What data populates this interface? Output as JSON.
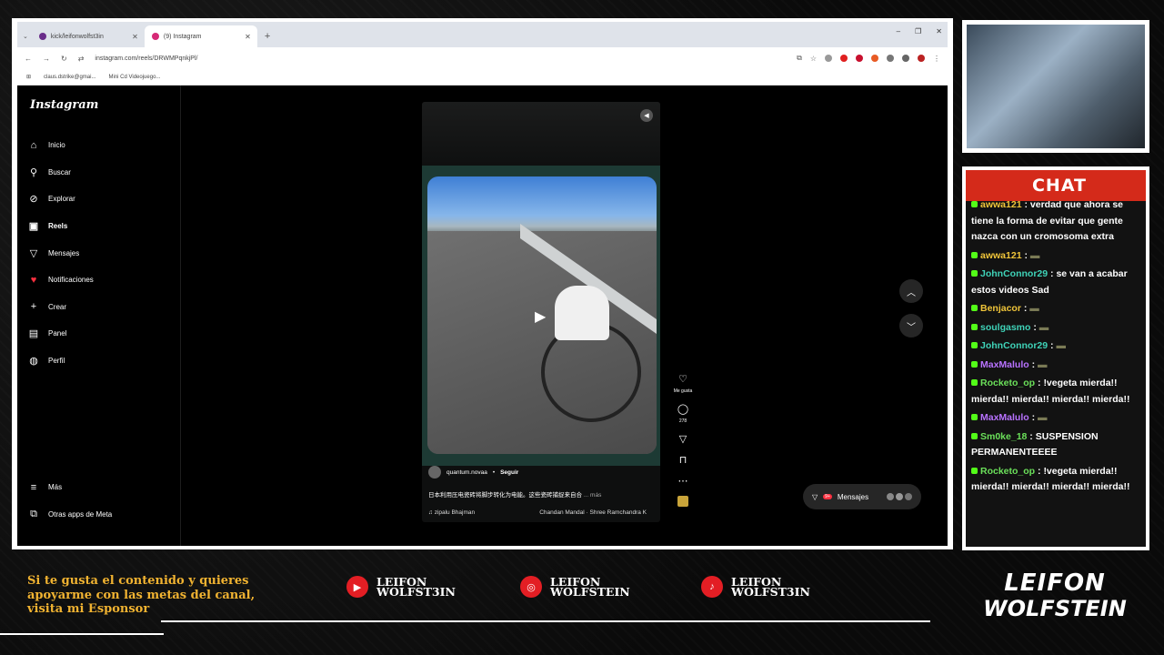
{
  "browser": {
    "tabs": [
      {
        "label": "kick/leifonwolfst3in"
      },
      {
        "label": "(9) Instagram"
      }
    ],
    "url": "instagram.com/reels/DRWMPqnkjPl/",
    "bookmarks": [
      "claus.dstrike@gmai...",
      "Mini Cd Videojuego..."
    ]
  },
  "instagram": {
    "logo": "Instagram",
    "nav": [
      "Inicio",
      "Buscar",
      "Explorar",
      "Reels",
      "Mensajes",
      "Notificaciones",
      "Crear",
      "Panel",
      "Perfil"
    ],
    "more": "Más",
    "meta_apps": "Otras apps de Meta"
  },
  "reel": {
    "username": "quantum.novaa",
    "follow": "Seguir",
    "caption": "日本利用压电瓷砖将脚步转化为电能。这些瓷砖捕捉来自合",
    "more": "... más",
    "audio_left": "zipalu Bhajman",
    "audio_right": "Chandan Mandal · Shree Ramchandra K",
    "like_label": "Me gusta",
    "comments": "278"
  },
  "messages": {
    "label": "Mensajes",
    "badge": "9+"
  },
  "chat": {
    "title": "CHAT",
    "colors": {
      "yellow": "#f0c53a",
      "green": "#6be05a",
      "teal": "#3fd3b8",
      "purple": "#b872ff"
    },
    "messages": [
      {
        "user": "awwa121",
        "color": "yellow",
        "text": "verdad que ahora se tiene la forma de evitar que gente nazca con un cromosoma extra"
      },
      {
        "user": "awwa121",
        "color": "yellow",
        "text": "[emote]"
      },
      {
        "user": "JohnConnor29",
        "color": "teal",
        "text": "se van a acabar estos videos Sad"
      },
      {
        "user": "Benjacor",
        "color": "yellow",
        "text": "[emote]"
      },
      {
        "user": "soulgasmo",
        "color": "teal",
        "text": "[emote]"
      },
      {
        "user": "JohnConnor29",
        "color": "teal",
        "text": "[emote]"
      },
      {
        "user": "MaxMalulo",
        "color": "purple",
        "text": "[emote]"
      },
      {
        "user": "Rocketo_op",
        "color": "green",
        "text": "!vegeta mierda!! mierda!! mierda!! mierda!! mierda!!"
      },
      {
        "user": "MaxMalulo",
        "color": "purple",
        "text": "[emote]"
      },
      {
        "user": "Sm0ke_18",
        "color": "green",
        "text": "SUSPENSION PERMANENTEEEE"
      },
      {
        "user": "Rocketo_op",
        "color": "green",
        "text": "!vegeta mierda!! mierda!! mierda!! mierda!! mierda!!"
      }
    ]
  },
  "footer": {
    "sponsor": [
      "Si te gusta el contenido y quieres",
      "apoyarme con las metas del canal,",
      "visita mi Esponsor"
    ],
    "social": [
      {
        "line1": "LEIFON",
        "line2": "WOLFST3IN"
      },
      {
        "line1": "LEIFON",
        "line2": "WOLFSTEIN"
      },
      {
        "line1": "LEIFON",
        "line2": "WOLFST3IN"
      }
    ],
    "brand": [
      "LEIFON",
      "WOLFSTEIN"
    ]
  }
}
